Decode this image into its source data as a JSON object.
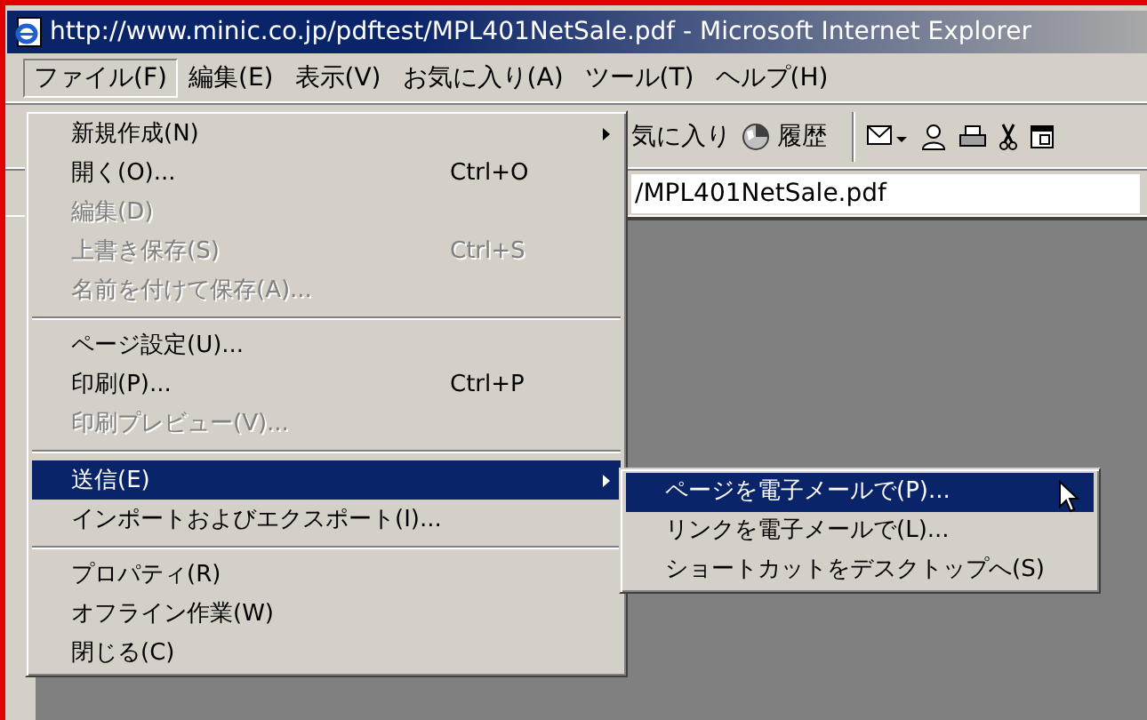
{
  "window": {
    "title": "http://www.minic.co.jp/pdftest/MPL401NetSale.pdf - Microsoft Internet Explorer"
  },
  "menu_bar": [
    {
      "label": "ファイル(F)",
      "selected": true
    },
    {
      "label": "編集(E)",
      "selected": false
    },
    {
      "label": "表示(V)",
      "selected": false
    },
    {
      "label": "お気に入り(A)",
      "selected": false
    },
    {
      "label": "ツール(T)",
      "selected": false
    },
    {
      "label": "ヘルプ(H)",
      "selected": false
    }
  ],
  "toolbar": {
    "favorites_label": "気に入り",
    "history_label": "履歴"
  },
  "address": {
    "value": "/MPL401NetSale.pdf"
  },
  "file_menu": {
    "items": [
      {
        "kind": "item",
        "label": "新規作成(N)",
        "submenu": true,
        "disabled": false,
        "selected": false
      },
      {
        "kind": "item",
        "label": "開く(O)...",
        "shortcut": "Ctrl+O",
        "submenu": false,
        "disabled": false,
        "selected": false
      },
      {
        "kind": "item",
        "label": "編集(D)",
        "submenu": false,
        "disabled": true,
        "selected": false
      },
      {
        "kind": "item",
        "label": "上書き保存(S)",
        "shortcut": "Ctrl+S",
        "submenu": false,
        "disabled": true,
        "selected": false
      },
      {
        "kind": "item",
        "label": "名前を付けて保存(A)...",
        "submenu": false,
        "disabled": true,
        "selected": false
      },
      {
        "kind": "separator"
      },
      {
        "kind": "item",
        "label": "ページ設定(U)...",
        "submenu": false,
        "disabled": false,
        "selected": false
      },
      {
        "kind": "item",
        "label": "印刷(P)...",
        "shortcut": "Ctrl+P",
        "submenu": false,
        "disabled": false,
        "selected": false
      },
      {
        "kind": "item",
        "label": "印刷プレビュー(V)...",
        "submenu": false,
        "disabled": true,
        "selected": false
      },
      {
        "kind": "separator"
      },
      {
        "kind": "item",
        "label": "送信(E)",
        "submenu": true,
        "disabled": false,
        "selected": true
      },
      {
        "kind": "item",
        "label": "インポートおよびエクスポート(I)...",
        "submenu": false,
        "disabled": false,
        "selected": false
      },
      {
        "kind": "separator"
      },
      {
        "kind": "item",
        "label": "プロパティ(R)",
        "submenu": false,
        "disabled": false,
        "selected": false
      },
      {
        "kind": "item",
        "label": "オフライン作業(W)",
        "submenu": false,
        "disabled": false,
        "selected": false
      },
      {
        "kind": "item",
        "label": "閉じる(C)",
        "submenu": false,
        "disabled": false,
        "selected": false
      }
    ]
  },
  "send_submenu": {
    "items": [
      {
        "label": "ページを電子メールで(P)...",
        "selected": true
      },
      {
        "label": "リンクを電子メールで(L)...",
        "selected": false
      },
      {
        "label": "ショートカットをデスクトップへ(S)",
        "selected": false
      }
    ]
  }
}
